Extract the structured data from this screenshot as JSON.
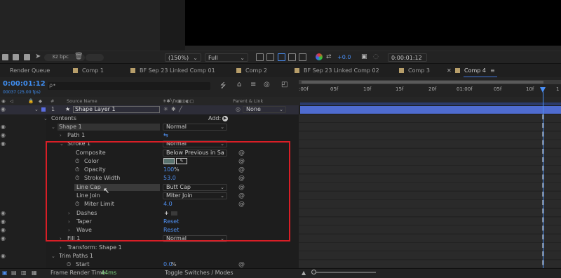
{
  "project_panel": {
    "bpc": "32 bpc"
  },
  "viewer_bar": {
    "zoom": "(150%)",
    "resolution": "Full",
    "exposure": "+0.0",
    "timecode": "0:00:01:12"
  },
  "tabs": [
    {
      "label": "Render Queue"
    },
    {
      "label": "Comp 1"
    },
    {
      "label": "BF Sep 23 Linked Comp 01"
    },
    {
      "label": "Comp 2"
    },
    {
      "label": "BF Sep 23 Linked Comp 02"
    },
    {
      "label": "Comp 3"
    },
    {
      "label": "Comp 4"
    }
  ],
  "comp": {
    "timecode": "0:00:01:12",
    "frames": "00037 (25.00 fps)",
    "search_placeholder": "ρ•"
  },
  "ruler": {
    "ticks": [
      ":00f",
      "05f",
      "10f",
      "15f",
      "20f",
      "01:00f",
      "05f",
      "10f",
      "1"
    ]
  },
  "columns": {
    "hash": "#",
    "source_name": "Source Name",
    "parent": "Parent & Link"
  },
  "layer1": {
    "number": "1",
    "star": "★",
    "name": "Shape Layer 1",
    "parent": "None"
  },
  "rows": {
    "contents": "Contents",
    "add": "Add:",
    "shape1": "Shape 1",
    "shape1_mode": "Normal",
    "path1": "Path 1",
    "stroke1": "Stroke 1",
    "stroke1_mode": "Normal",
    "composite": "Composite",
    "composite_value": "Below Previous in Sa",
    "color": "Color",
    "opacity": "Opacity",
    "opacity_value": "100",
    "opacity_unit": "%",
    "stroke_width": "Stroke Width",
    "stroke_width_value": "53.0",
    "line_cap": "Line Cap",
    "line_cap_value": "Butt Cap",
    "line_join": "Line Join",
    "line_join_value": "Miter Join",
    "miter_limit": "Miter Limit",
    "miter_limit_value": "4.0",
    "dashes": "Dashes",
    "dashes_add": "+",
    "taper": "Taper",
    "taper_value": "Reset",
    "wave": "Wave",
    "wave_value": "Reset",
    "fill1": "Fill 1",
    "fill1_mode": "Normal",
    "transform_shape1": "Transform: Shape 1",
    "trim_paths1": "Trim Paths 1",
    "start": "Start",
    "start_value": "0.0",
    "start_unit": "%"
  },
  "bottom": {
    "render_time_label": "Frame Render Time",
    "render_time_value": "44ms",
    "toggle": "Toggle Switches / Modes"
  },
  "colors": {
    "accent_blue": "#3f8df0",
    "highlight_red": "#d91e26",
    "layer_bar": "#4f6cd0",
    "tab_swatch": "#b79e6a",
    "stroke_color": "#59726e"
  }
}
